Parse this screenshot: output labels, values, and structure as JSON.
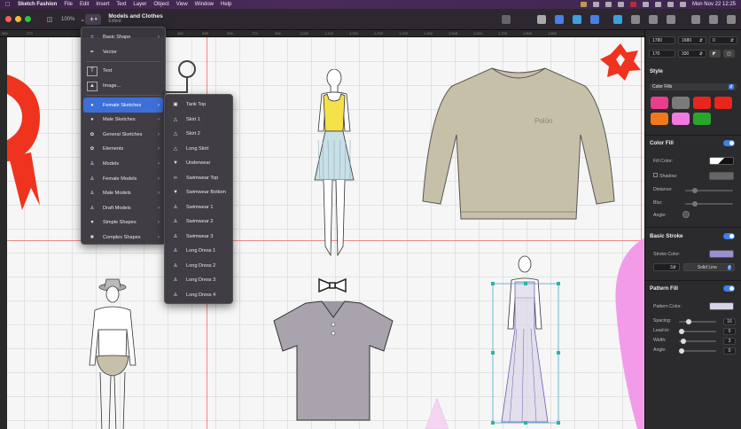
{
  "menubar": {
    "app": "Sketch Fashion",
    "items": [
      "File",
      "Edit",
      "Insert",
      "Text",
      "Layer",
      "Object",
      "View",
      "Window",
      "Help"
    ],
    "datetime": "Mon Nov 22  12:25"
  },
  "toolbar": {
    "zoom": "100%",
    "doc_title": "Models and Clothes",
    "doc_subtitle": "Edited"
  },
  "ruler": [
    "300",
    "370",
    "465",
    "498",
    "596",
    "774",
    "860",
    "946",
    "1,032",
    "1,118",
    "1,204",
    "1,290",
    "1,376",
    "1,462",
    "1,548",
    "1,634",
    "1,720",
    "1,806",
    "1,892"
  ],
  "menu_primary": [
    {
      "label": "Basic Shape",
      "icon": "star-icon",
      "arrow": true
    },
    {
      "label": "Vector",
      "icon": "pen-icon",
      "arrow": false
    },
    {
      "sep": true
    },
    {
      "label": "Text",
      "icon": "text-icon",
      "arrow": false
    },
    {
      "label": "Image...",
      "icon": "image-icon",
      "arrow": false
    },
    {
      "sep": true
    },
    {
      "label": "Female Sketches",
      "icon": "female-head-icon",
      "arrow": true,
      "selected": true
    },
    {
      "label": "Male Sketches",
      "icon": "male-head-icon",
      "arrow": true
    },
    {
      "label": "General Sketches",
      "icon": "general-sketch-icon",
      "arrow": true
    },
    {
      "label": "Elements",
      "icon": "elements-icon",
      "arrow": true
    },
    {
      "label": "Models",
      "icon": "models-icon",
      "arrow": true
    },
    {
      "label": "Female Models",
      "icon": "female-model-icon",
      "arrow": true
    },
    {
      "label": "Male Models",
      "icon": "male-model-icon",
      "arrow": true
    },
    {
      "label": "Draft Models",
      "icon": "draft-model-icon",
      "arrow": true
    },
    {
      "label": "Simple Shapes",
      "icon": "heart-icon",
      "arrow": true
    },
    {
      "label": "Complex Shapes",
      "icon": "complex-shape-icon",
      "arrow": true
    }
  ],
  "menu_sub": [
    {
      "label": "Tank Top",
      "icon": "tank-top-icon"
    },
    {
      "label": "Skirt 1",
      "icon": "skirt-icon"
    },
    {
      "label": "Skirt 2",
      "icon": "skirt-icon"
    },
    {
      "label": "Long Skirt",
      "icon": "long-skirt-icon"
    },
    {
      "label": "Underwear",
      "icon": "underwear-icon"
    },
    {
      "label": "Swimwear Top",
      "icon": "swimwear-top-icon"
    },
    {
      "label": "Swimwear Bottom",
      "icon": "swimwear-bottom-icon"
    },
    {
      "label": "Swimwear 1",
      "icon": "swimwear-icon"
    },
    {
      "label": "Swimwear 2",
      "icon": "swimwear-icon"
    },
    {
      "label": "Swimwear 3",
      "icon": "swimwear-icon"
    },
    {
      "label": "Long Dress 1",
      "icon": "dress-icon"
    },
    {
      "label": "Long Dress 2",
      "icon": "dress-icon"
    },
    {
      "label": "Long Dress 3",
      "icon": "dress-icon"
    },
    {
      "label": "Long Dress 4",
      "icon": "dress-icon"
    }
  ],
  "sweater_text": "Polón",
  "panel": {
    "x": "1780",
    "y": "1680",
    "rotation": "0",
    "w": "170",
    "h": "330",
    "style_title": "Style",
    "color_fills": "Color Fills",
    "swatches": [
      "#e83e8c",
      "#7a7a7a",
      "#e8261c",
      "#e8261c",
      "#f07a1a",
      "#f07ae0",
      "#2aa52a"
    ],
    "color_fill_title": "Color Fill",
    "fill_color_label": "Fill Color:",
    "shadow_label": "Shadow:",
    "distance_label": "Distance:",
    "blur_label": "Blur:",
    "angle_label": "Angle:",
    "basic_stroke_title": "Basic Stroke",
    "stroke_color_label": "Stroke Color:",
    "stroke_width": "3",
    "stroke_style": "Solid Line",
    "pattern_fill_title": "Pattern Fill",
    "pattern_color_label": "Pattern Color:",
    "spacing_label": "Spacing:",
    "spacing_val": "16",
    "leadin_label": "Lead-in:",
    "leadin_val": "0",
    "width_label": "Width:",
    "width_val": "3",
    "pangle_label": "Angle:",
    "pangle_val": "0",
    "stroke_swatch": "#9a8fd0",
    "pattern_swatch": "#d8d4e8"
  }
}
